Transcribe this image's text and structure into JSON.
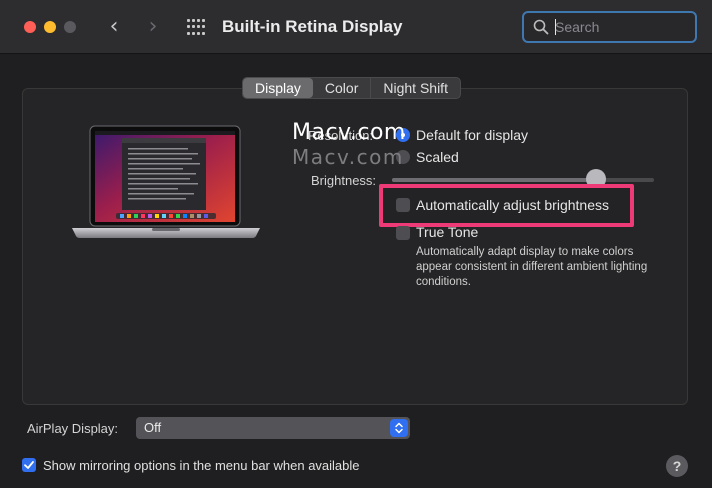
{
  "window": {
    "title": "Built-in Retina Display"
  },
  "nav": {
    "back_icon": "chevron-left-icon",
    "forward_icon": "chevron-right-icon",
    "grid_icon": "grid-icon"
  },
  "search": {
    "placeholder": "Search",
    "value": ""
  },
  "tabs": [
    {
      "label": "Display",
      "active": true
    },
    {
      "label": "Color",
      "active": false
    },
    {
      "label": "Night Shift",
      "active": false
    }
  ],
  "display": {
    "resolution_label": "Resolution:",
    "options": [
      {
        "label": "Default for display",
        "selected": true
      },
      {
        "label": "Scaled",
        "selected": false
      }
    ],
    "brightness_label": "Brightness:",
    "brightness_level": 0.78,
    "auto_brightness_label": "Automatically adjust brightness",
    "auto_brightness_checked": false,
    "true_tone_label": "True Tone",
    "true_tone_checked": false,
    "true_tone_description": "Automatically adapt display to make colors appear consistent in different ambient lighting conditions."
  },
  "watermark": {
    "line1": "Macv.com",
    "line2": "Macv.com"
  },
  "airplay": {
    "label": "AirPlay Display:",
    "value": "Off"
  },
  "mirroring": {
    "label": "Show mirroring options in the menu bar when available",
    "checked": true
  },
  "help": {
    "label": "?"
  },
  "colors": {
    "accent": "#2f6ff0",
    "highlight": "#ee3a77",
    "search_focus": "#3f77b0"
  }
}
